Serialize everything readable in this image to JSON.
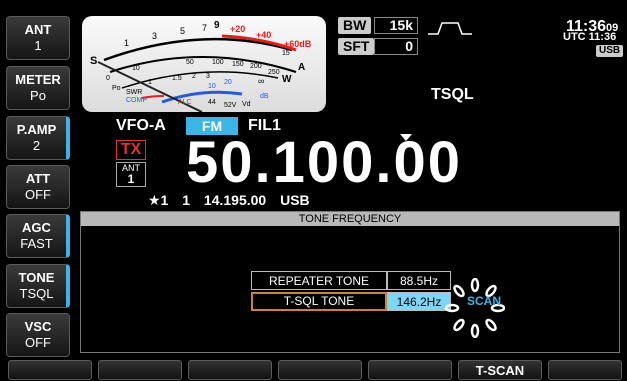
{
  "left_buttons": [
    {
      "title": "ANT",
      "value": "1",
      "active": false
    },
    {
      "title": "METER",
      "value": "Po",
      "active": false
    },
    {
      "title": "P.AMP",
      "value": "2",
      "active": true
    },
    {
      "title": "ATT",
      "value": "OFF",
      "active": false
    },
    {
      "title": "AGC",
      "value": "FAST",
      "active": true
    },
    {
      "title": "TONE",
      "value": "TSQL",
      "active": true
    },
    {
      "title": "VSC",
      "value": "OFF",
      "active": false
    }
  ],
  "meter": {
    "s_label": "S",
    "s_scale": [
      "1",
      "3",
      "5",
      "7",
      "9",
      "+20",
      "+40",
      "+60dB"
    ],
    "po_label": "Po",
    "po_scale": [
      "0",
      "10",
      "50",
      "100",
      "150",
      "200",
      "250"
    ],
    "a_label": "A",
    "a_scale": [
      "5",
      "10",
      "15"
    ],
    "w_label": "W",
    "swr_label": "SWR",
    "swr_scale": [
      "1",
      "1.5",
      "2",
      "3",
      "∞"
    ],
    "comp_label": "COMP",
    "comp_scale": [
      "10",
      "20",
      "dB"
    ],
    "alc_label": "ALC",
    "vd_scale": [
      "44",
      "52V",
      "Vd"
    ],
    "id_label": "Id",
    "colors": {
      "red": "#e0201e",
      "blue": "#2a5ad8",
      "needle": "#222222"
    }
  },
  "status": {
    "bw_tag": "BW",
    "bw_value": "15k",
    "sft_tag": "SFT",
    "sft_value": "0",
    "clock_hm": "11:36",
    "clock_sec": "09",
    "utc": "UTC 11:36",
    "usb_badge": "USB",
    "tone_mode": "TSQL"
  },
  "vfo": {
    "name": "VFO-A",
    "mode": "FM",
    "filter": "FIL1",
    "tx": "TX",
    "ant_label": "ANT",
    "ant_value": "1",
    "frequency": "50.100.00",
    "sub_star": "★1",
    "sub_num": "1",
    "sub_freq": "14.195.00",
    "sub_mode": "USB"
  },
  "tone_panel": {
    "title": "TONE FREQUENCY",
    "rows": [
      {
        "label": "REPEATER TONE",
        "value": "88.5Hz"
      },
      {
        "label": "T-SQL TONE",
        "value": "146.2Hz"
      }
    ],
    "scan_label": "SCAN"
  },
  "bottom_buttons": [
    "",
    "",
    "",
    "",
    "",
    "T-SCAN",
    ""
  ],
  "accent": "#3ab5e8"
}
